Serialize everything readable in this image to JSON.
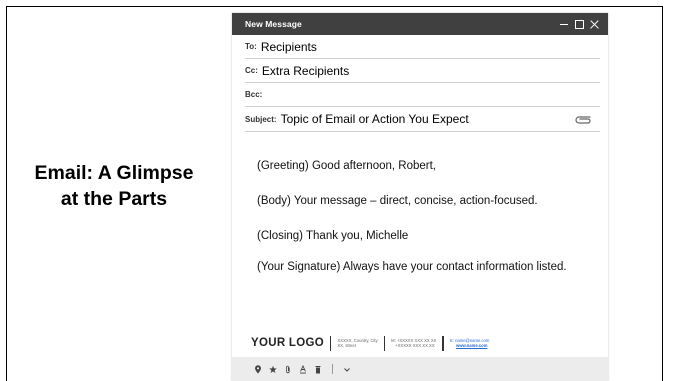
{
  "slide": {
    "title_line1": "Email: A Glimpse",
    "title_line2": "at the Parts"
  },
  "compose": {
    "title": "New Message",
    "to": {
      "label": "To:",
      "value": "Recipients"
    },
    "cc": {
      "label": "Cc:",
      "value": "Extra Recipients"
    },
    "bcc": {
      "label": "Bcc:",
      "value": ""
    },
    "subject": {
      "label": "Subject:",
      "value": "Topic of Email or Action You Expect"
    },
    "body": {
      "greeting": "(Greeting)  Good afternoon, Robert,",
      "message": "(Body) Your message – direct, concise, action-focused.",
      "closing": "(Closing) Thank you, Michelle",
      "signature_note": "(Your Signature)  Always have your contact information listed."
    },
    "signature_block": {
      "logo": "YOUR LOGO",
      "address_line1": "XXXXX, Country, City",
      "address_line2": "XX, street",
      "phone_line1": "M: +XXXXX XXX XX XX",
      "phone_line2": "+XXXXX XXX XX XX",
      "email": "E: name@name.com",
      "website": "www.name.com"
    },
    "toolbar_icons": [
      "location-icon",
      "star-icon",
      "attach-icon",
      "text-format-icon",
      "trash-icon",
      "more-icon"
    ]
  },
  "colors": {
    "header_bg": "#404040",
    "link": "#2a6ad8",
    "toolbar_bg": "#ececec"
  }
}
